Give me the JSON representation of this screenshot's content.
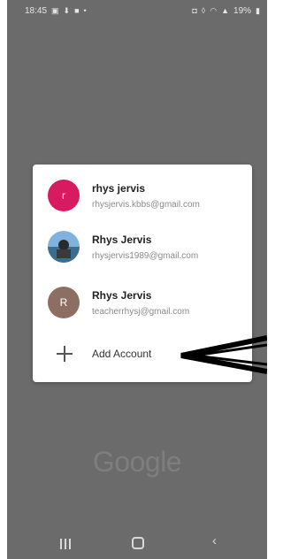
{
  "status_bar": {
    "time": "18:45",
    "left_icons": [
      "image-icon",
      "download-icon",
      "lock-icon",
      "dot-icon"
    ],
    "battery": "19%"
  },
  "accounts": [
    {
      "name": "rhys jervis",
      "email": "rhysjervis.kbbs@gmail.com",
      "avatar_letter": "r",
      "avatar_color": "#d81b60"
    },
    {
      "name": "Rhys Jervis",
      "email": "rhysjervis1989@gmail.com",
      "avatar_letter": "",
      "avatar_color": "#4f8fc0"
    },
    {
      "name": "Rhys Jervis",
      "email": "teacherrhysj@gmail.com",
      "avatar_letter": "R",
      "avatar_color": "#8d6e63"
    }
  ],
  "add_account": {
    "label": "Add Account",
    "icon": "plus-icon"
  },
  "logo": "Google",
  "nav_bar": {
    "recent": "recent-apps-icon",
    "home": "home-icon",
    "back": "back-icon"
  },
  "colors": {
    "scrim": "#6b6b6b",
    "dialog": "#ffffff",
    "annotation": "#000000"
  }
}
